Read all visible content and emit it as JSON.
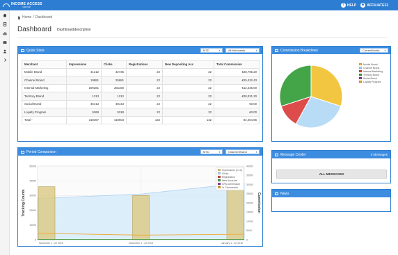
{
  "topbar": {
    "logo_text": "INCOME ACCESS",
    "logo_sub": "GROUP",
    "help_icon_glyph": "?",
    "help_label": "HELP",
    "user_label": "AFFILIATE12"
  },
  "sidebar": {
    "icons": [
      "home-icon",
      "document-icon",
      "bar-chart-icon",
      "envelope-icon",
      "user-icon",
      "chevron-right-icon"
    ]
  },
  "breadcrumb": {
    "home": "Home",
    "separator": "/",
    "current": "Dashboard"
  },
  "page": {
    "title": "Dashboard",
    "description": "Dashboarddescription"
  },
  "quick_stats": {
    "title": "Quick Stats",
    "period_select": "MTD",
    "merchant_select": "All Merchants",
    "columns": [
      "Merchant",
      "Impressions",
      "Clicks",
      "Registrations",
      "New Depositing Acc",
      "Total Commission"
    ],
    "rows": [
      [
        "Mobile Brand",
        "41212",
        "32736",
        "22",
        "22",
        "€28,795.20"
      ],
      [
        "Channel Brand",
        "19881",
        "25681",
        "22",
        "22",
        "€25,432.43"
      ],
      [
        "Internal Marketing",
        "209281",
        "281160",
        "22",
        "22",
        "€12,236.00"
      ],
      [
        "Territory Brand",
        "1313",
        "1212",
        "22",
        "22",
        "€28,031.20"
      ],
      [
        "Social Brand",
        "45413",
        "48143",
        "22",
        "22",
        "€0.00"
      ],
      [
        "Loyalty Program",
        "5368",
        "5318",
        "22",
        "22",
        "€0.00"
      ],
      [
        "Total -",
        "318367",
        "418603",
        "132",
        "132",
        "84,464.86"
      ]
    ]
  },
  "commission_breakdown": {
    "title": "Commission Breakdown",
    "period_select": "CurrentMonth",
    "legend": [
      {
        "label": "Mobile Brand",
        "color": "#f2c641"
      },
      {
        "label": "Channel Brand",
        "color": "#b9dcf6"
      },
      {
        "label": "Internal Marketing",
        "color": "#dd4b4b"
      },
      {
        "label": "Territory Brand",
        "color": "#43a547"
      },
      {
        "label": "Social Brand",
        "color": "#8e44ad"
      },
      {
        "label": "Loyalty Program",
        "color": "#f0a830"
      }
    ],
    "slices": [
      {
        "name": "Mobile Brand",
        "percent": 30,
        "color": "#f2c641"
      },
      {
        "name": "Channel Brand",
        "percent": 28,
        "color": "#b9dcf6"
      },
      {
        "name": "Internal Marketing",
        "percent": 12,
        "color": "#dd4b4b"
      },
      {
        "name": "Territory Brand",
        "percent": 30,
        "color": "#43a547"
      }
    ]
  },
  "period_comparison": {
    "title": "Period Comparison",
    "period_select": "MTD",
    "brand_select": "Channel Brand",
    "legend": [
      {
        "label": "Impressions (1:10)",
        "color": "#f2dc8e"
      },
      {
        "label": "Clicks",
        "color": "#b9dcf6"
      },
      {
        "label": "Registration",
        "color": "#dd4b4b"
      },
      {
        "label": "New Accounts",
        "color": "#43a547"
      },
      {
        "label": "CPA commission",
        "color": "#8e44ad"
      },
      {
        "label": "% Commission",
        "color": "#f0a830"
      }
    ]
  },
  "chart_data": {
    "type": "bar",
    "xlabel": "",
    "ylabel": "Tracking Counts",
    "y2label": "Commission",
    "ylim": [
      0,
      50000
    ],
    "y2lim": [
      0,
      40000
    ],
    "yticks": [
      "0",
      "10000",
      "20000",
      "30000",
      "40000",
      "50000"
    ],
    "y2ticks": [
      "0",
      "5000",
      "10000",
      "15000",
      "20000",
      "25000",
      "30000",
      "35000",
      "40000"
    ],
    "categories": [
      "November 1 - 22 2015",
      "December 1 - 22 2015",
      "January 1 - 22 2016"
    ],
    "series": [
      {
        "name": "Impressions (1:10)",
        "type": "bar",
        "values": [
          36000,
          30000,
          41000
        ]
      },
      {
        "name": "Clicks",
        "type": "area",
        "values": [
          28000,
          31000,
          38500
        ]
      },
      {
        "name": "Registration",
        "type": "line",
        "values": [
          200,
          200,
          200
        ]
      },
      {
        "name": "New Accounts",
        "type": "line",
        "values": [
          200,
          200,
          200
        ]
      },
      {
        "name": "% Commission",
        "type": "line",
        "values": [
          3500,
          2500,
          3000
        ]
      }
    ],
    "grid": true,
    "legend_position": "top-right"
  },
  "message_center": {
    "title": "Message Center",
    "count_label": "0 Messages",
    "button_label": "ALL MESSAGES"
  },
  "news": {
    "title": "News"
  }
}
